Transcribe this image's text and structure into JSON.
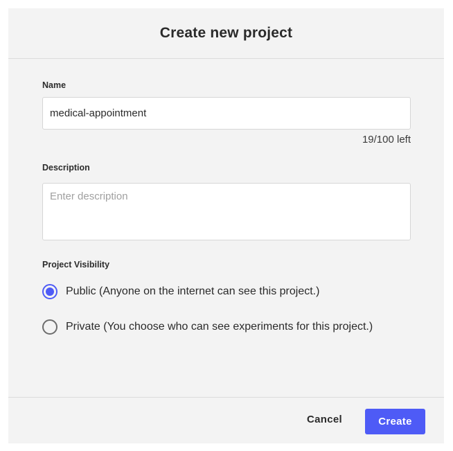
{
  "dialog": {
    "title": "Create new project"
  },
  "name_field": {
    "label": "Name",
    "value": "medical-appointment",
    "char_count": "19/100 left"
  },
  "description_field": {
    "label": "Description",
    "value": "",
    "placeholder": "Enter description"
  },
  "visibility": {
    "label": "Project Visibility",
    "options": [
      {
        "label": "Public (Anyone on the internet can see this project.)",
        "selected": true
      },
      {
        "label": "Private (You choose who can see experiments for this project.)",
        "selected": false
      }
    ]
  },
  "footer": {
    "cancel_label": "Cancel",
    "create_label": "Create"
  },
  "colors": {
    "accent": "#4e5bf6",
    "dialog_bg": "#f3f3f3"
  }
}
